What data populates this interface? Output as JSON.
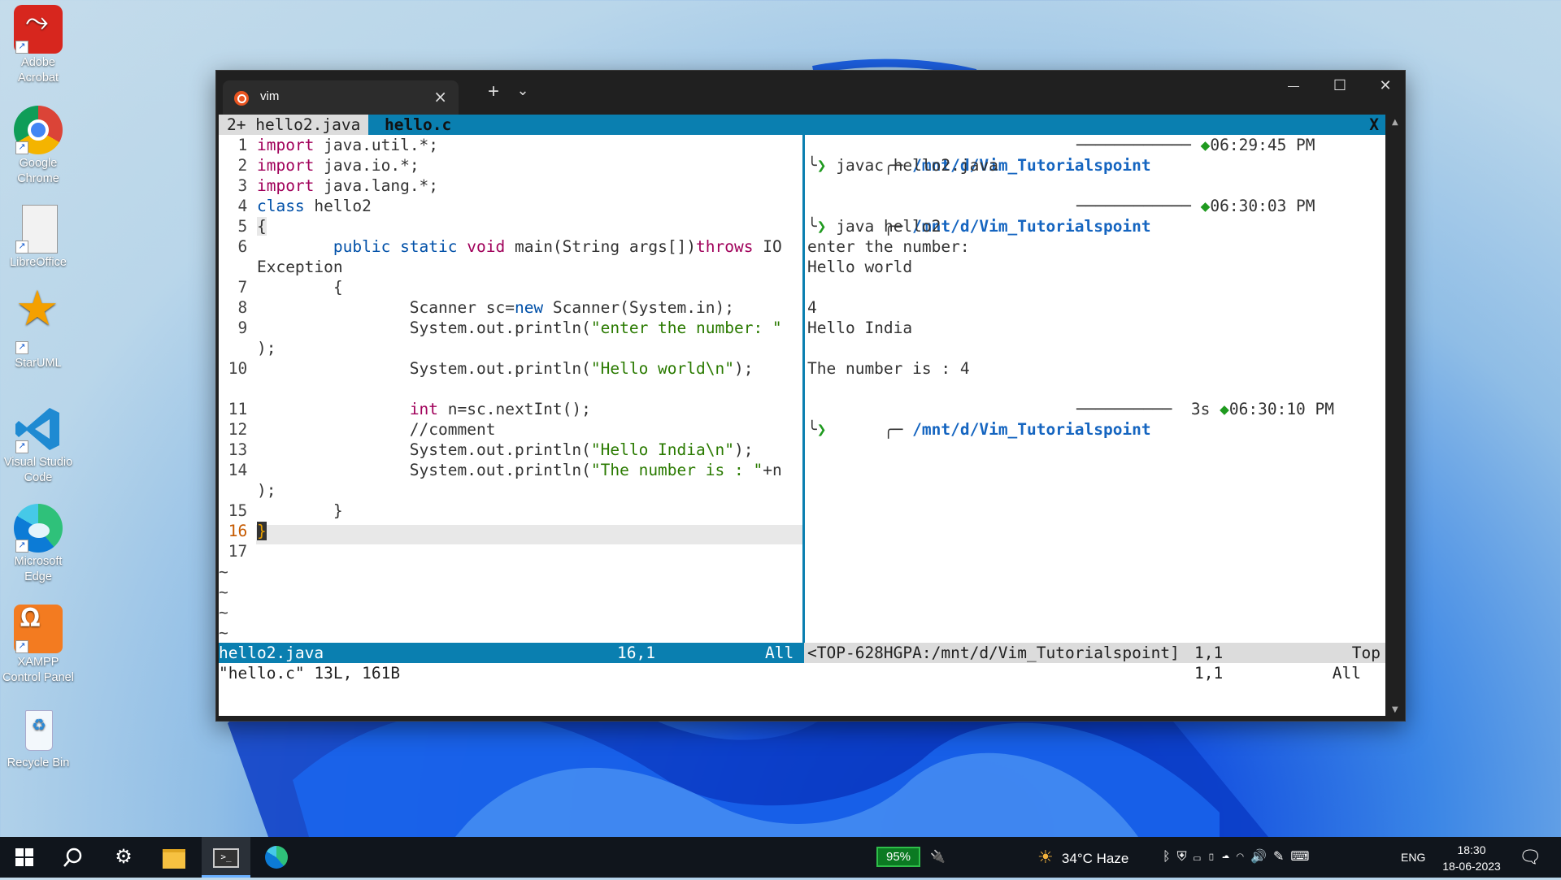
{
  "desktop": {
    "icons": [
      {
        "label": "Adobe Acrobat",
        "icon": "adobe-acrobat-icon"
      },
      {
        "label": "Google Chrome",
        "icon": "chrome-icon"
      },
      {
        "label": "LibreOffice",
        "icon": "libreoffice-icon"
      },
      {
        "label": "StarUML",
        "icon": "staruml-icon"
      },
      {
        "label": "Visual Studio Code",
        "icon": "vscode-icon"
      },
      {
        "label": "Microsoft Edge",
        "icon": "edge-icon"
      },
      {
        "label": "XAMPP Control Panel",
        "icon": "xampp-icon"
      },
      {
        "label": "Recycle Bin",
        "icon": "recycle-bin-icon"
      }
    ]
  },
  "window": {
    "tab_title": "vim",
    "new_tab": "+",
    "dropdown": "⌄",
    "min": "—",
    "max": "☐",
    "close": "✕"
  },
  "vim": {
    "tabline": {
      "tab1": "2+ hello2.java",
      "tab2": "hello.c",
      "close": "X"
    },
    "status_left": {
      "file": "hello2.java",
      "pos": "16,1",
      "scroll": "All"
    },
    "status_right": {
      "file": "<TOP-628HGPA:/mnt/d/Vim_Tutorialspoint]",
      "pos": "1,1",
      "scroll": "Top"
    },
    "cmdline": {
      "msg": "\"hello.c\" 13L, 161B",
      "pos": "1,1",
      "scroll": "All"
    },
    "code": [
      {
        "n": "1",
        "parts": [
          [
            "kw-i",
            "import"
          ],
          [
            "",
            "java.util.*;"
          ]
        ]
      }
    ]
  },
  "terminal": {
    "prompt1": {
      "path": "/mnt/d/Vim_Tutorialspoint",
      "time": "06:29:45 PM",
      "cmd": "javac hello2.java"
    },
    "prompt2": {
      "path": "/mnt/d/Vim_Tutorialspoint",
      "time": "06:30:03 PM",
      "cmd": "java hello2"
    },
    "output": [
      "enter the number:",
      "Hello world",
      "",
      "4",
      "Hello India",
      "",
      "The number is : 4"
    ],
    "prompt3": {
      "path": "/mnt/d/Vim_Tutorialspoint",
      "duration": "3s",
      "time": "06:30:10 PM"
    }
  },
  "taskbar": {
    "battery": "95%",
    "weather": "34°C  Haze",
    "lang": "ENG",
    "time": "18:30",
    "date": "18-06-2023"
  }
}
